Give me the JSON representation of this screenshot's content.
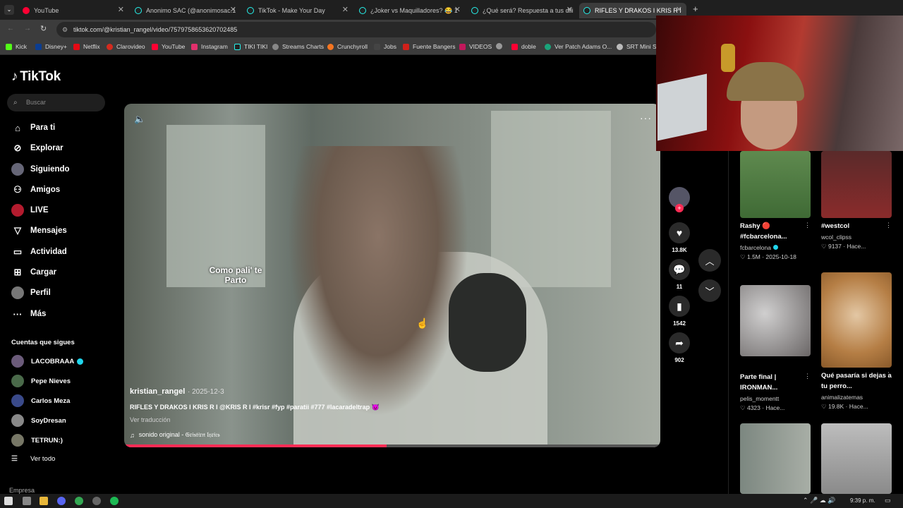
{
  "browser": {
    "tabs": [
      {
        "title": "YouTube",
        "color": "#ff0033"
      },
      {
        "title": "Anonimo SAC (@anonimosac.1",
        "color": "#25f4ee"
      },
      {
        "title": "TikTok - Make Your Day",
        "color": "#25f4ee"
      },
      {
        "title": "¿Joker vs Maquilladores? 😂 1",
        "color": "#25f4ee"
      },
      {
        "title": "¿Qué será? Respuesta a tus dili",
        "color": "#25f4ee"
      },
      {
        "title": "RIFLES Y DRAKOS I KRIS R I",
        "color": "#25f4ee"
      }
    ],
    "url": "tiktok.com/@kristian_rangel/video/7579758653620702485",
    "bookmarks": [
      "Kick",
      "Disney+",
      "Netflix",
      "Clarovideo",
      "YouTube",
      "Instagram",
      "TIKI TIKI",
      "Streams Charts",
      "Crunchyroll",
      "Jobs",
      "Fuente Bangers",
      "VIDEOS",
      "",
      "doble",
      "Ver Patch Adams O...",
      "SRT Mini Se"
    ]
  },
  "sidebar": {
    "logo": "TikTok",
    "search_placeholder": "Buscar",
    "nav": [
      {
        "label": "Para ti",
        "icon": "home-icon"
      },
      {
        "label": "Explorar",
        "icon": "compass-icon"
      },
      {
        "label": "Siguiendo",
        "icon": "following-icon"
      },
      {
        "label": "Amigos",
        "icon": "friends-icon"
      },
      {
        "label": "LIVE",
        "icon": "live-icon"
      },
      {
        "label": "Mensajes",
        "icon": "messages-icon"
      },
      {
        "label": "Actividad",
        "icon": "activity-icon"
      },
      {
        "label": "Cargar",
        "icon": "upload-icon"
      },
      {
        "label": "Perfil",
        "icon": "profile-icon"
      },
      {
        "label": "Más",
        "icon": "more-icon"
      }
    ],
    "following_title": "Cuentas que sigues",
    "following": [
      "LACOBRAAA",
      "Pepe Nieves",
      "Carlos Meza",
      "SoyDresan",
      "TETRUN:)"
    ],
    "see_all": "Ver todo",
    "footer": "Empresa"
  },
  "video": {
    "caption_overlay": "Como pali' te\nParto",
    "author": "kristian_rangel",
    "date": "· 2025-12-3",
    "description": "RIFLES Y DRAKOS I KRIS R I @KRIS R I #krisr #fyp #paratii #777 #lacaradeltrap 😈",
    "translate": "Ver traducción",
    "sound": "sonido original - 𝔊𝔯𝔦𝔰𝔱𝔦𝔯𝔫 𝔩𝔶𝔯𝔦𝔠𝔰",
    "progress": 0.49,
    "accent": "#fe2c55"
  },
  "actions": {
    "likes": "13.8K",
    "comments": "11",
    "saves": "1542",
    "shares": "902"
  },
  "recommendations": [
    {
      "title": "Rashy 🔴 #fcbarcelona...",
      "user": "fcbarcelona",
      "stats": "♡ 1.5M · 2025-10-18"
    },
    {
      "title": "#westcol",
      "user": "wcol_clipss",
      "stats": "♡ 9137 · Hace..."
    },
    {
      "title": "Parte final | IRONMAN...",
      "user": "pelis_momentt",
      "stats": "♡ 4323 · Hace..."
    },
    {
      "title": "Qué pasaría si dejas a tu perro...",
      "user": "animalizatemas",
      "stats": "♡ 19.8K · Hace..."
    }
  ],
  "taskbar": {
    "time": "9:39 p. m."
  }
}
